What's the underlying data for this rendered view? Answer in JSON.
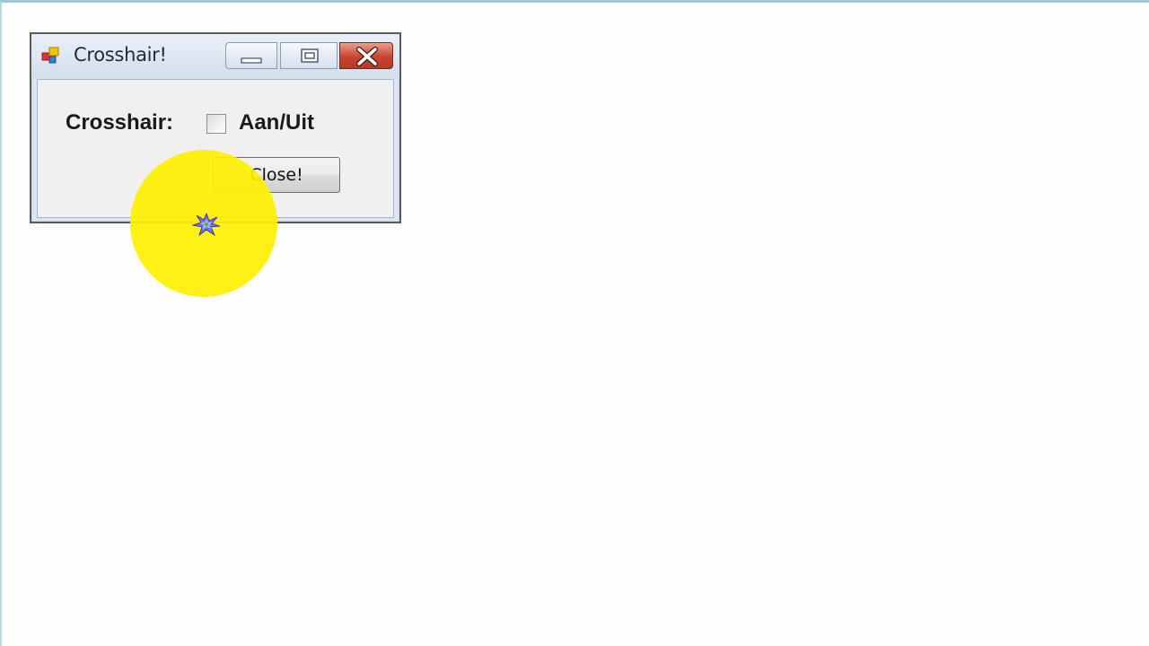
{
  "window": {
    "title": "Crosshair!",
    "buttons": {
      "minimize_icon": "minimize-icon",
      "maximize_icon": "restore-icon",
      "close_icon": "close-icon"
    }
  },
  "form": {
    "crosshair_label": "Crosshair:",
    "toggle_label": "Aan/Uit",
    "toggle_checked": false,
    "close_button_label": "Close!"
  },
  "colors": {
    "cursor_highlight": "#fff000",
    "close_button_red": "#c8452f",
    "titlebar": "#dce6f2"
  }
}
